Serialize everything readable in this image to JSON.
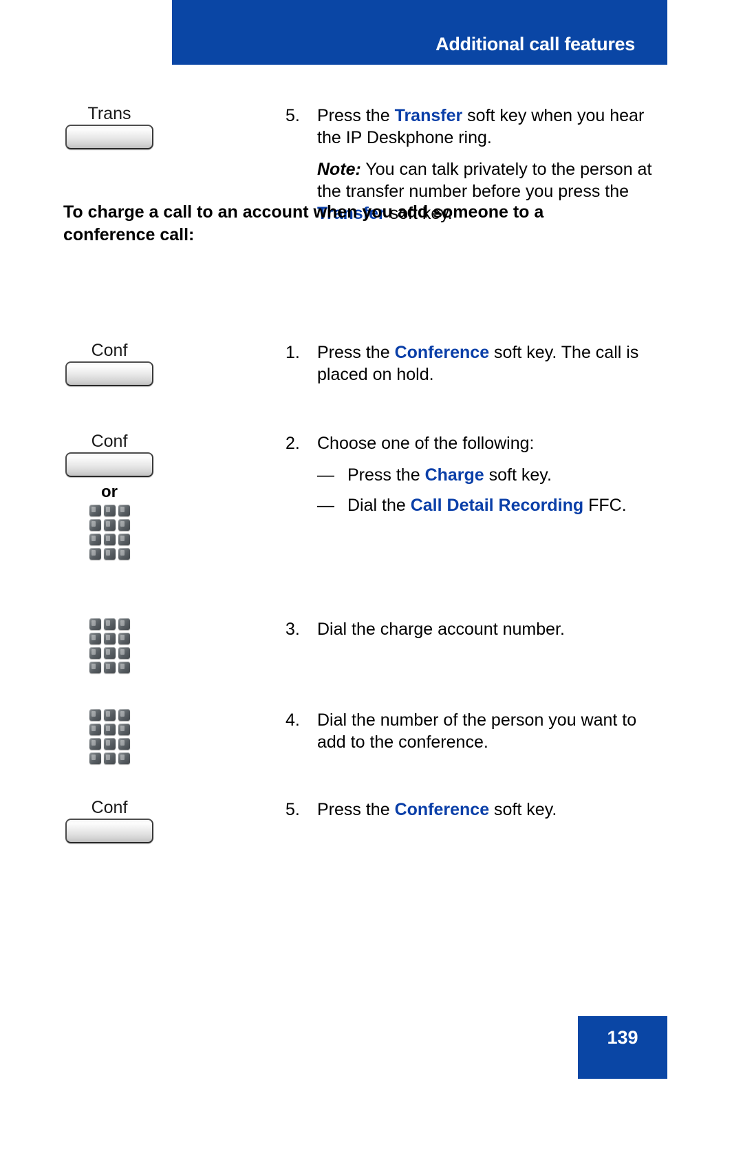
{
  "header": {
    "title": "Additional call features",
    "bar_color": "#0a46a5"
  },
  "accent_color": "#0a3fa8",
  "section_heading": "To charge a call to an account when you add someone to a conference call:",
  "labels": {
    "or": "or",
    "trans_key": "Trans",
    "conf_key": "Conf",
    "em_dash": "—"
  },
  "steps": [
    {
      "number": "5.",
      "softkey_label": "Trans",
      "icon": "softkey-button",
      "text_parts": [
        {
          "t": "Press the ",
          "style": "plain"
        },
        {
          "t": "Transfer",
          "style": "keyword"
        },
        {
          "t": " soft key when you hear the IP Deskphone ring.",
          "style": "plain"
        }
      ],
      "note_parts": [
        {
          "t": "Note:",
          "style": "note-label"
        },
        {
          "t": " You can talk privately to the person at the transfer number before you press the ",
          "style": "plain"
        },
        {
          "t": "Transfer",
          "style": "keyword"
        },
        {
          "t": " soft key.",
          "style": "plain"
        }
      ]
    },
    {
      "number": "1.",
      "softkey_label": "Conf",
      "icon": "softkey-button",
      "text_parts": [
        {
          "t": "Press the ",
          "style": "plain"
        },
        {
          "t": "Conference",
          "style": "keyword"
        },
        {
          "t": " soft key. The call is placed on hold.",
          "style": "plain"
        }
      ]
    },
    {
      "number": "2.",
      "softkey_label": "Conf",
      "icon": "softkey-button-or-keypad",
      "text_parts": [
        {
          "t": "Choose one of the following:",
          "style": "plain"
        }
      ],
      "sub_items": [
        [
          {
            "t": "Press the ",
            "style": "plain"
          },
          {
            "t": "Charge",
            "style": "keyword"
          },
          {
            "t": " soft key.",
            "style": "plain"
          }
        ],
        [
          {
            "t": "Dial the ",
            "style": "plain"
          },
          {
            "t": "Call Detail Recording",
            "style": "keyword"
          },
          {
            "t": " FFC.",
            "style": "plain"
          }
        ]
      ]
    },
    {
      "number": "3.",
      "softkey_label": "",
      "icon": "keypad",
      "text_parts": [
        {
          "t": "Dial the charge account number.",
          "style": "plain"
        }
      ]
    },
    {
      "number": "4.",
      "softkey_label": "",
      "icon": "keypad",
      "text_parts": [
        {
          "t": "Dial the number of the person you want to add to the conference.",
          "style": "plain"
        }
      ]
    },
    {
      "number": "5.",
      "softkey_label": "Conf",
      "icon": "softkey-button",
      "text_parts": [
        {
          "t": "Press the ",
          "style": "plain"
        },
        {
          "t": "Conference",
          "style": "keyword"
        },
        {
          "t": " soft key.",
          "style": "plain"
        }
      ]
    }
  ],
  "footer": {
    "page_number": "139"
  }
}
